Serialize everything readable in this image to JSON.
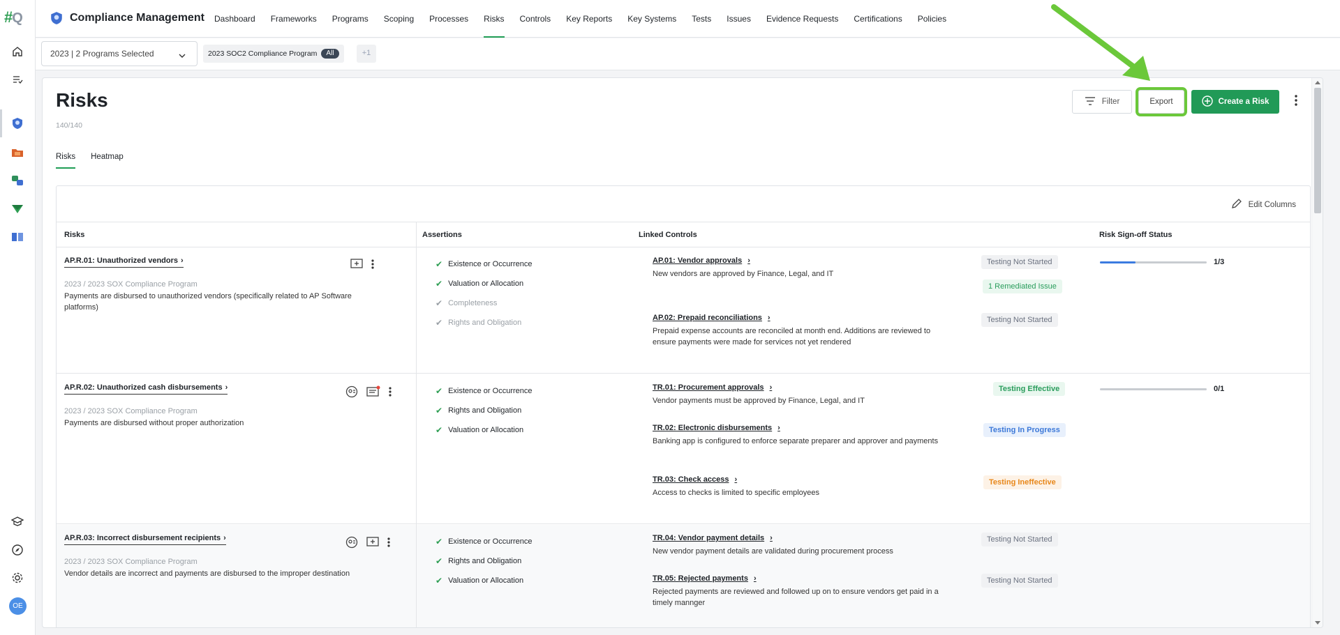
{
  "rail": {
    "logo_main": "#",
    "logo_sub": "Q",
    "avatar": "OE"
  },
  "app": {
    "title": "Compliance Management"
  },
  "nav": {
    "items": [
      "Dashboard",
      "Frameworks",
      "Programs",
      "Scoping",
      "Processes",
      "Risks",
      "Controls",
      "Key Reports",
      "Key Systems",
      "Tests",
      "Issues",
      "Evidence Requests",
      "Certifications",
      "Policies"
    ],
    "active": "Risks"
  },
  "program_bar": {
    "selector": "2023 | 2 Programs Selected",
    "chip_label": "2023 SOC2 Compliance Program",
    "chip_badge": "All",
    "more": "+1"
  },
  "page": {
    "title": "Risks",
    "count": "140/140",
    "tabs": [
      "Risks",
      "Heatmap"
    ],
    "filter_label": "Filter",
    "export_label": "Export",
    "create_label": "Create a Risk",
    "edit_columns": "Edit Columns"
  },
  "table": {
    "headers": [
      "Risks",
      "Assertions",
      "Linked Controls",
      "Risk Sign-off Status"
    ],
    "rows": [
      {
        "id": "AP.R.01: Unauthorized vendors",
        "program": "2023 / 2023 SOX Compliance Program",
        "desc": "Payments are disbursed to unauthorized vendors (specifically related to AP Software platforms)",
        "assertions": [
          "Existence or Occurrence",
          "Valuation or Allocation",
          "Completeness",
          "Rights and Obligation"
        ],
        "controls": [
          {
            "name": "AP.01: Vendor approvals",
            "desc": "New vendors are approved by Finance, Legal, and IT",
            "status": "Testing Not Started",
            "extra": "1 Remediated Issue"
          },
          {
            "name": "AP.02: Prepaid reconciliations",
            "desc": "Prepaid expense accounts are reconciled at month end. Additions are reviewed to ensure payments were made for services not yet rendered",
            "status": "Testing Not Started"
          }
        ],
        "signoff": "1/3",
        "signoff_fraction": 0.333
      },
      {
        "id": "AP.R.02: Unauthorized cash disbursements",
        "program": "2023 / 2023 SOX Compliance Program",
        "desc": "Payments are disbursed without proper authorization",
        "assertions": [
          "Existence or Occurrence",
          "Rights and Obligation",
          "Valuation or Allocation"
        ],
        "controls": [
          {
            "name": "TR.01: Procurement approvals",
            "desc": "Vendor payments must be approved by Finance, Legal, and IT",
            "status": "Testing Effective"
          },
          {
            "name": "TR.02: Electronic disbursements",
            "desc": "Banking app is configured to enforce separate preparer and approver and payments",
            "status": "Testing In Progress"
          },
          {
            "name": "TR.03: Check access",
            "desc": "Access to checks is limited to specific employees",
            "status": "Testing Ineffective"
          }
        ],
        "signoff": "0/1",
        "signoff_fraction": 0
      },
      {
        "id": "AP.R.03: Incorrect disbursement recipients",
        "program": "2023 / 2023 SOX Compliance Program",
        "desc": "Vendor details are incorrect and payments are disbursed to the improper destination",
        "assertions": [
          "Existence or Occurrence",
          "Rights and Obligation",
          "Valuation or Allocation"
        ],
        "controls": [
          {
            "name": "TR.04: Vendor payment details",
            "desc": "New vendor payment details are validated during procurement process",
            "status": "Testing Not Started"
          },
          {
            "name": "TR.05: Rejected payments",
            "desc": "Rejected payments are reviewed and followed up on to ensure vendors get paid in a timely mannger",
            "status": "Testing Not Started"
          }
        ]
      }
    ]
  },
  "colors": {
    "accent": "#219a57",
    "annotation": "#6bc83a",
    "progress": "#3b7be0"
  }
}
